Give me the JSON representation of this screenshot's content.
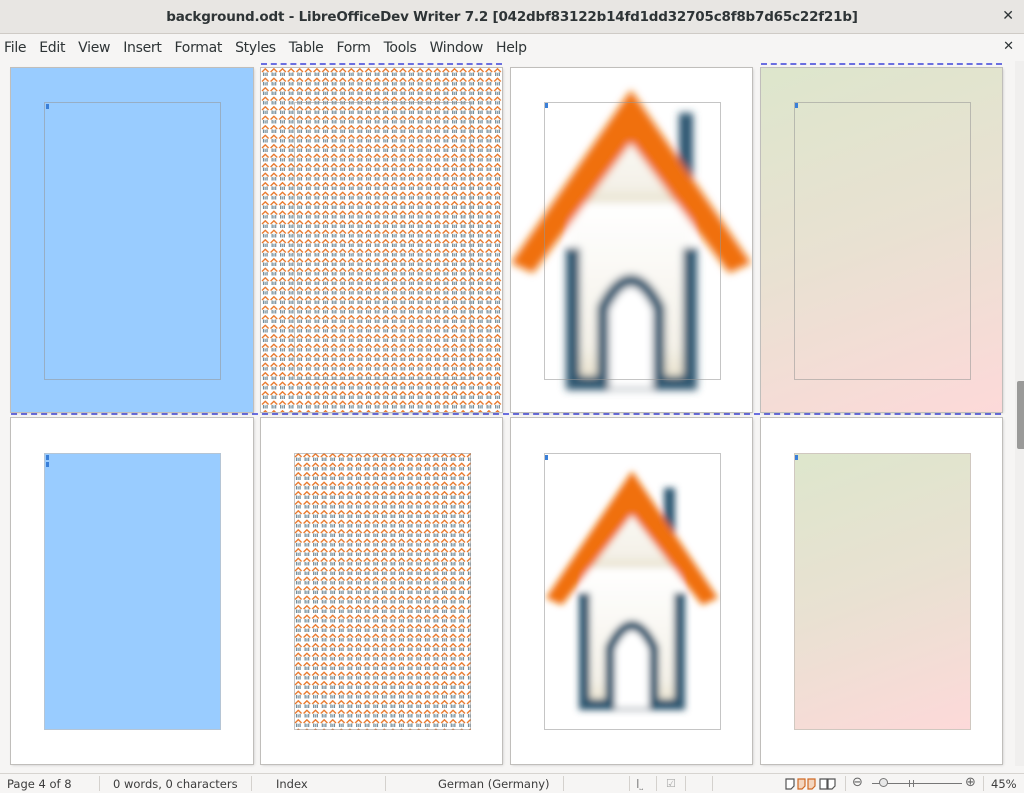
{
  "window": {
    "title": "background.odt - LibreOfficeDev Writer 7.2 [042dbf83122b14fd1dd32705c8f8b7d65c22f21b]",
    "close_icon": "close-icon"
  },
  "menu": {
    "items": [
      "File",
      "Edit",
      "View",
      "Insert",
      "Format",
      "Styles",
      "Table",
      "Form",
      "Tools",
      "Window",
      "Help"
    ],
    "close_document_icon": "close-icon"
  },
  "document": {
    "pages": [
      {
        "number": 1,
        "background": "solid-color",
        "color": "#99ccff",
        "scope": "full-page"
      },
      {
        "number": 2,
        "background": "tiled-house-bitmap",
        "scope": "full-page"
      },
      {
        "number": 3,
        "background": "stretched-house-bitmap",
        "scope": "full-page"
      },
      {
        "number": 4,
        "background": "gradient",
        "colors": [
          "#dde6cc",
          "#fdd9d9"
        ],
        "scope": "full-page"
      },
      {
        "number": 5,
        "background": "solid-color",
        "color": "#99ccff",
        "scope": "text-area"
      },
      {
        "number": 6,
        "background": "tiled-house-bitmap",
        "scope": "text-area"
      },
      {
        "number": 7,
        "background": "stretched-house-bitmap",
        "scope": "text-area"
      },
      {
        "number": 8,
        "background": "gradient",
        "colors": [
          "#dde6cc",
          "#fdd9d9"
        ],
        "scope": "text-area"
      }
    ],
    "page_break_color": "#6b6fe0"
  },
  "statusbar": {
    "page": "Page 4 of 8",
    "word_count": "0 words, 0 characters",
    "page_style": "Index",
    "language": "German (Germany)",
    "insert_mode_icon": "text-cursor-icon",
    "selection_mode_icon": "document-modified-icon",
    "view_layouts": [
      "single-page-view-icon",
      "multi-page-view-icon",
      "book-view-icon"
    ],
    "zoom_out_icon": "zoom-out-icon",
    "zoom_in_icon": "zoom-in-icon",
    "zoom_level": "45%",
    "zoom_percent": 45
  }
}
